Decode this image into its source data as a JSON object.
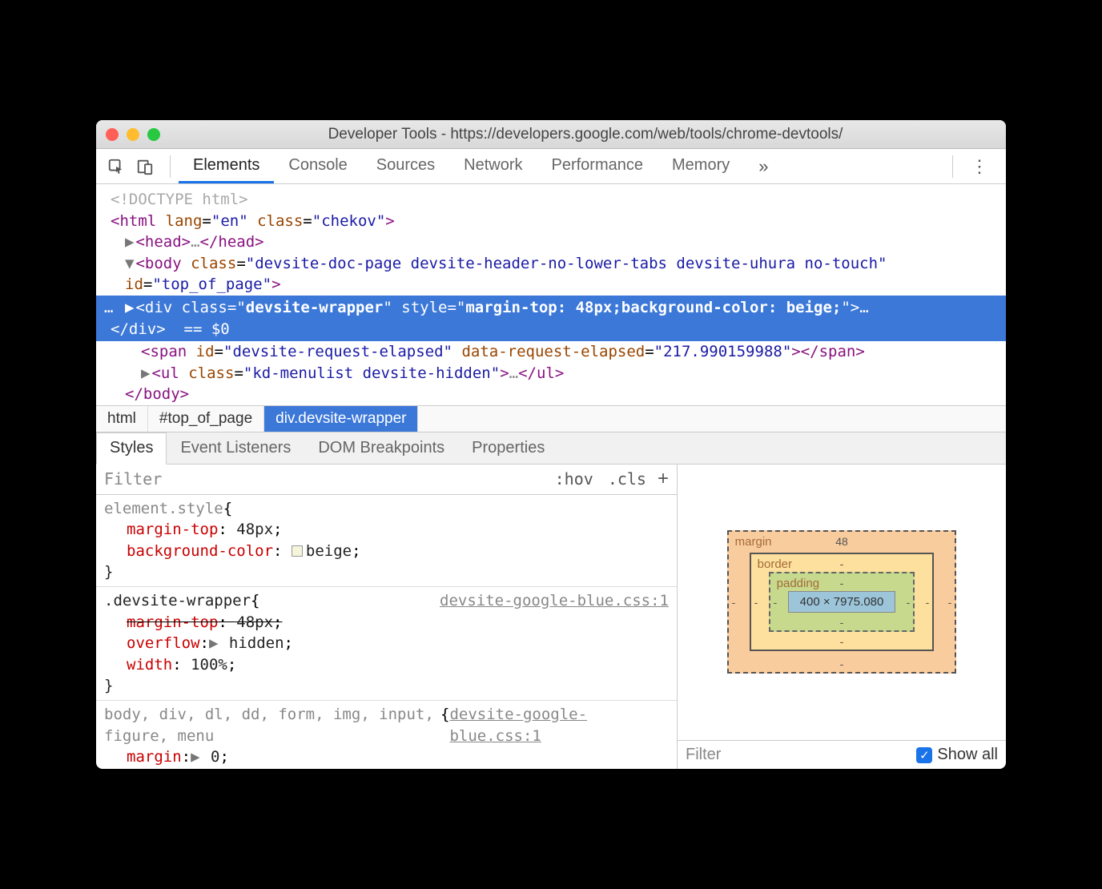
{
  "window": {
    "title": "Developer Tools - https://developers.google.com/web/tools/chrome-devtools/"
  },
  "toolbar": {
    "tabs": [
      "Elements",
      "Console",
      "Sources",
      "Network",
      "Performance",
      "Memory"
    ],
    "active_tab": 0
  },
  "dom": {
    "doctype": "<!DOCTYPE html>",
    "html_open": "<html lang=\"en\" class=\"chekov\">",
    "head": "<head>…</head>",
    "body_open": "<body class=\"devsite-doc-page devsite-header-no-lower-tabs devsite-uhura no-touch\" id=\"top_of_page\">",
    "selected": {
      "open": "<div class=\"devsite-wrapper\" style=\"margin-top: 48px;background-color: beige;\">…</div>",
      "eq": "== $0"
    },
    "span_line": "<span id=\"devsite-request-elapsed\" data-request-elapsed=\"217.990159988\"></span>",
    "ul_line": "<ul class=\"kd-menulist devsite-hidden\">…</ul>",
    "body_close": "</body>"
  },
  "breadcrumb": [
    "html",
    "#top_of_page",
    "div.devsite-wrapper"
  ],
  "subtabs": [
    "Styles",
    "Event Listeners",
    "DOM Breakpoints",
    "Properties"
  ],
  "filter": {
    "placeholder": "Filter",
    "hov": ":hov",
    "cls": ".cls"
  },
  "styles": {
    "element_style": {
      "selector": "element.style",
      "decls": [
        {
          "prop": "margin-top",
          "val": "48px"
        },
        {
          "prop": "background-color",
          "val": "beige",
          "swatch": true
        }
      ]
    },
    "rule1": {
      "selector": ".devsite-wrapper",
      "source": "devsite-google-blue.css:1",
      "decls": [
        {
          "prop": "margin-top",
          "val": "48px",
          "struck": true
        },
        {
          "prop": "overflow",
          "val": "hidden",
          "arrow": true
        },
        {
          "prop": "width",
          "val": "100%"
        }
      ]
    },
    "rule2": {
      "selector": "body, div, dl, dd, form, img, input, figure, menu",
      "source": "devsite-google-blue.css:1",
      "decl_partial": {
        "prop": "margin",
        "val": "0"
      }
    }
  },
  "box_model": {
    "margin": {
      "label": "margin",
      "top": "48",
      "right": "-",
      "bottom": "-",
      "left": "-"
    },
    "border": {
      "label": "border",
      "top": "-",
      "right": "-",
      "bottom": "-",
      "left": "-"
    },
    "padding": {
      "label": "padding",
      "top": "-",
      "right": "-",
      "bottom": "-",
      "left": "-"
    },
    "content": "400 × 7975.080"
  },
  "computed_filter": {
    "placeholder": "Filter",
    "show_all_label": "Show all",
    "show_all_checked": true
  }
}
